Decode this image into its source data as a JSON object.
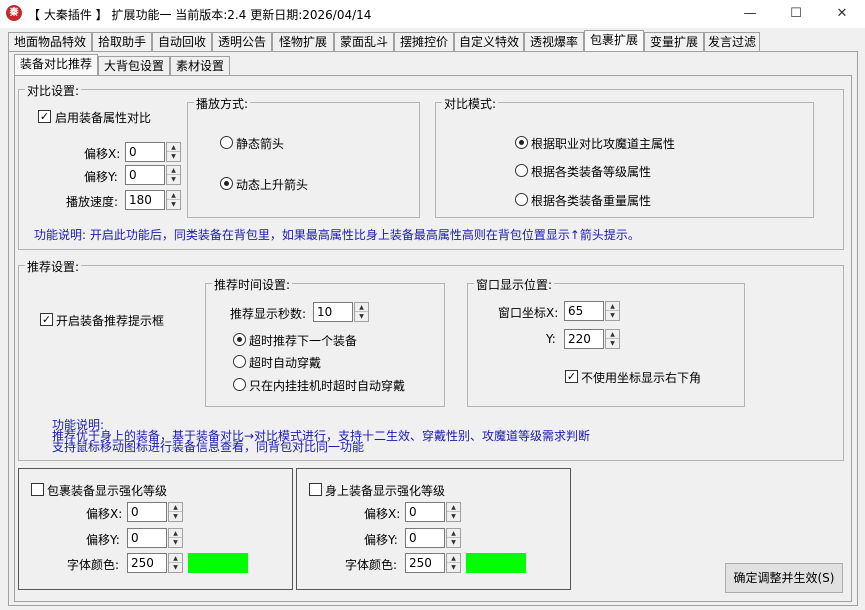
{
  "window": {
    "title": "【 大秦插件 】 扩展功能一 当前版本:2.4 更新日期:2026/04/14",
    "icon_text": "秦",
    "min_label": "—",
    "max_label": "☐",
    "close_label": "✕"
  },
  "main_tabs": [
    "地面物品特效",
    "拾取助手",
    "自动回收",
    "透明公告",
    "怪物扩展",
    "蒙面乱斗",
    "摆摊控价",
    "自定义特效",
    "透视爆率",
    "包裹扩展",
    "变量扩展",
    "发言过滤"
  ],
  "main_tab_active": "包裹扩展",
  "sub_tabs": [
    "装备对比推荐",
    "大背包设置",
    "素材设置"
  ],
  "sub_tab_active": "装备对比推荐",
  "compare": {
    "title": "对比设置:",
    "enable_label": "启用装备属性对比",
    "enable_checked": true,
    "offset_x_label": "偏移X:",
    "offset_x": "0",
    "offset_y_label": "偏移Y:",
    "offset_y": "0",
    "speed_label": "播放速度:",
    "speed": "180",
    "play_group_title": "播放方式:",
    "play_options": [
      "静态箭头",
      "动态上升箭头"
    ],
    "play_selected": 1,
    "mode_group_title": "对比模式:",
    "mode_options": [
      "根据职业对比攻魔道主属性",
      "根据各类装备等级属性",
      "根据各类装备重量属性"
    ],
    "mode_selected": 0,
    "desc": "功能说明: 开启此功能后，同类装备在背包里，如果最高属性比身上装备最高属性高则在背包位置显示↑箭头提示。"
  },
  "recommend": {
    "title": "推荐设置:",
    "enable_label": "开启装备推荐提示框",
    "enable_checked": true,
    "time_group_title": "推荐时间设置:",
    "seconds_label": "推荐显示秒数:",
    "seconds": "10",
    "time_options": [
      "超时推荐下一个装备",
      "超时自动穿戴",
      "只在内挂挂机时超时自动穿戴"
    ],
    "time_selected": 0,
    "pos_group_title": "窗口显示位置:",
    "pos_x_label": "窗口坐标X:",
    "pos_x": "65",
    "pos_y_label": "Y:",
    "pos_y": "220",
    "no_coord_label": "不使用坐标显示右下角",
    "no_coord_checked": true,
    "desc_title": "功能说明:",
    "desc_line1": "推荐优于身上的装备，基于装备对比→对比模式进行，支持十二生效、穿戴性别、攻魔道等级需求判断",
    "desc_line2": "支持鼠标移动图标进行装备信息查看，同背包对比同一功能"
  },
  "bag_strength": {
    "label": "包裹装备显示强化等级",
    "checked": false,
    "offset_x_label": "偏移X:",
    "offset_x": "0",
    "offset_y_label": "偏移Y:",
    "offset_y": "0",
    "color_label": "字体颜色:",
    "color_value": "250",
    "swatch_color": "#00ff00"
  },
  "body_strength": {
    "label": "身上装备显示强化等级",
    "checked": false,
    "offset_x_label": "偏移X:",
    "offset_x": "0",
    "offset_y_label": "偏移Y:",
    "offset_y": "0",
    "color_label": "字体颜色:",
    "color_value": "250",
    "swatch_color": "#00ff00"
  },
  "confirm_button": "确定调整并生效(S)"
}
